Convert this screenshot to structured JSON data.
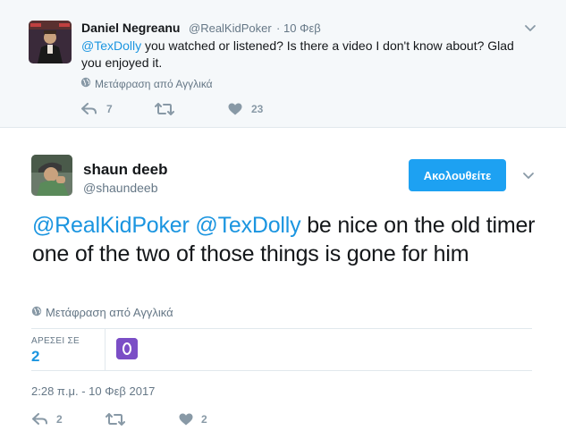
{
  "parent_tweet": {
    "name": "Daniel Negreanu",
    "handle": "@RealKidPoker",
    "separator": "·",
    "time": "10 Φεβ",
    "text_mention": "@TexDolly",
    "text_body": " you watched or listened? Is there a video I don't know about? Glad you enjoyed it.",
    "translate_label": "Μετάφραση από Αγγλικά",
    "reply_count": "7",
    "retweet_count": "",
    "like_count": "23"
  },
  "main_tweet": {
    "name": "shaun deeb",
    "handle": "@shaundeeb",
    "follow_label": "Ακολουθείτε",
    "text_mention_1": "@RealKidPoker",
    "text_mention_2": "@TexDolly",
    "text_body": " be nice on the old timer one of the two of those things is gone for him",
    "translate_label": "Μετάφραση από Αγγλικά",
    "likes_label": "ΑΡΕΣΕΙ ΣΕ",
    "likes_value": "2",
    "date": "2:28 π.μ. - 10 Φεβ 2017",
    "reply_count": "2",
    "retweet_count": "",
    "like_count": "2"
  },
  "colors": {
    "link": "#1b95e0",
    "button": "#1da1f2",
    "muted": "#657786",
    "icon": "#8899a6",
    "parent_bg": "#f5f8fa"
  },
  "icons": [
    "globe-icon",
    "reply-icon",
    "retweet-icon",
    "heart-icon",
    "chevron-down-icon"
  ]
}
